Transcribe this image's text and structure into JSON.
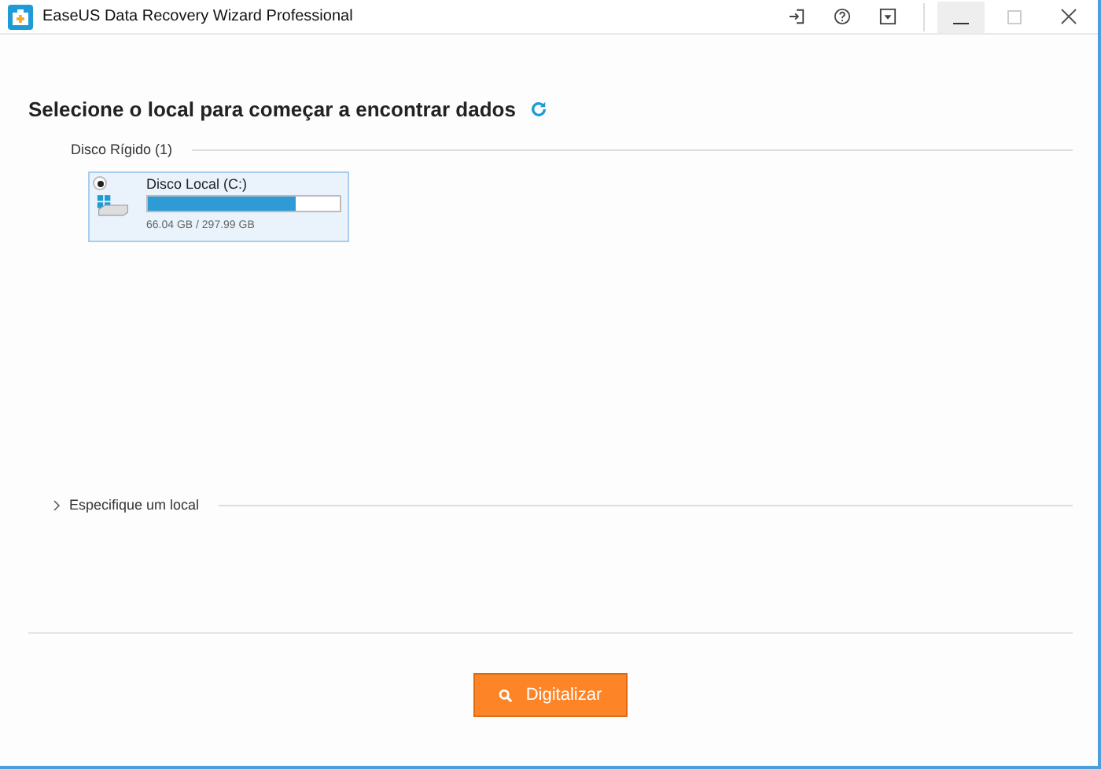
{
  "window": {
    "title": "EaseUS Data Recovery Wizard Professional"
  },
  "heading": "Selecione o local para começar a encontrar dados",
  "disk_section": {
    "label": "Disco Rígido (1)"
  },
  "drives": [
    {
      "name": "Disco Local (C:)",
      "usage": "66.04 GB / 297.99 GB",
      "level": 0.77,
      "selected": true
    }
  ],
  "location_section": {
    "label": "Especifique um local",
    "expanded": false
  },
  "scan_button": {
    "label": "Digitalizar"
  }
}
